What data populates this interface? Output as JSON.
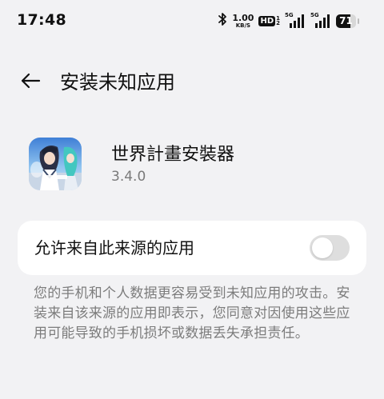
{
  "status_bar": {
    "time": "17:48",
    "network_speed": {
      "value": "1.00",
      "unit": "KB/S"
    },
    "hd_badge": "HD",
    "hd_sub": [
      "1",
      "2"
    ],
    "signal_1": {
      "tag": "5G",
      "level": 4
    },
    "signal_2": {
      "tag": "5G",
      "level": 4
    },
    "battery_percent": "71",
    "battery_level": 0.71,
    "icons": [
      "bluetooth-icon",
      "hd-icon",
      "signal-icon",
      "signal-icon",
      "battery-icon"
    ]
  },
  "header": {
    "title": "安装未知应用",
    "back_icon": "arrow-left-icon"
  },
  "app": {
    "name": "世界計畫安裝器",
    "version": "3.4.0"
  },
  "setting": {
    "label": "允许来自此来源的应用",
    "enabled": false
  },
  "description": "您的手机和个人数据更容易受到未知应用的攻击。安装来自该来源的应用即表示，您同意对因使用这些应用可能导致的手机损坏或数据丢失承担责任。",
  "colors": {
    "background": "#f2f2f4",
    "card": "#ffffff",
    "toggle_off": "#dedede",
    "secondary_text": "#7c7c7c"
  }
}
